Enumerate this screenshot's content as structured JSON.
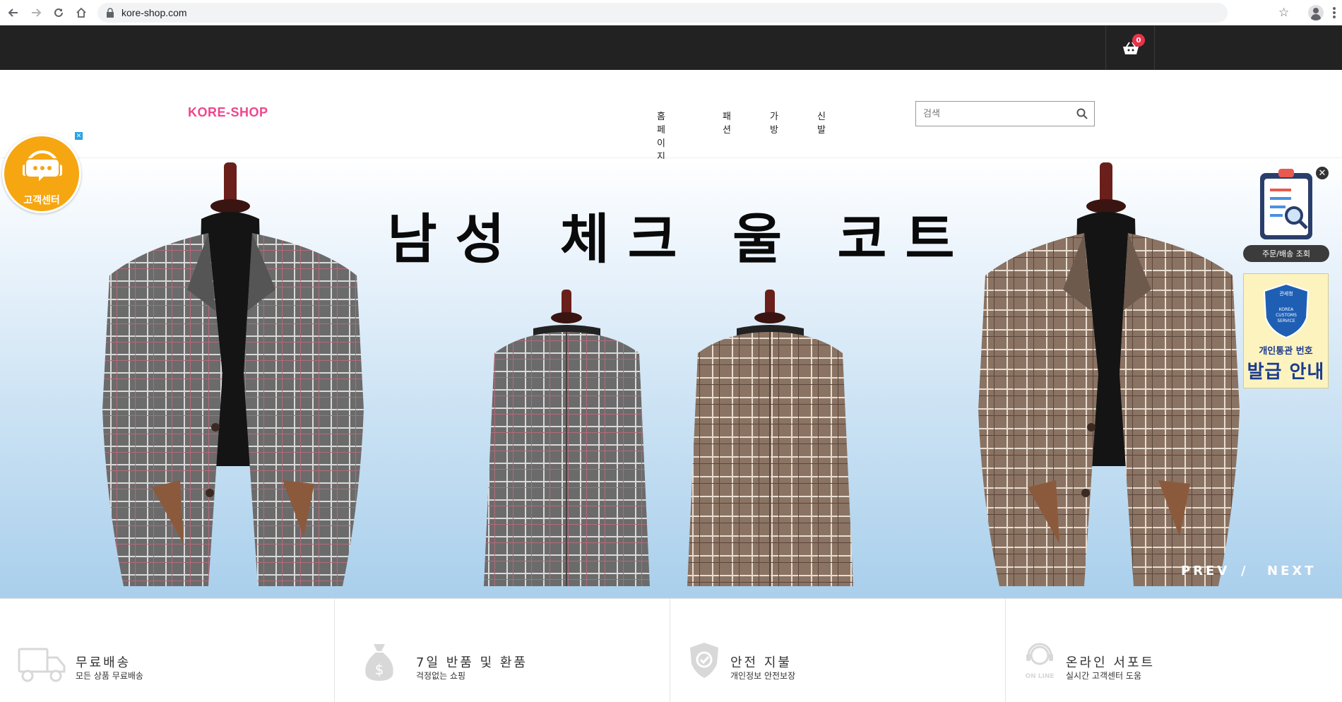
{
  "browser": {
    "url": "kore-shop.com"
  },
  "topbar": {
    "cart_count": "0"
  },
  "header": {
    "logo": "KORE-SHOP",
    "menu": [
      {
        "label": "홈페이지"
      },
      {
        "label": "패션"
      },
      {
        "label": "가방"
      },
      {
        "label": "신발"
      }
    ],
    "search_placeholder": "검색"
  },
  "hero": {
    "title": "남성 체크 울 코트",
    "prev_label": "PREV",
    "slash": "/",
    "next_label": "NEXT"
  },
  "widgets": {
    "customer_center": "고객센터",
    "order_lookup": "주문/배송 조회",
    "customs_line1": "개인통관 번호",
    "customs_line2": "발급 안내",
    "customs_badge_top": "관세청",
    "customs_badge_text": "KOREA CUSTOMS SERVICE"
  },
  "features": [
    {
      "title": "무료배송",
      "subtitle": "모든 상품 무료배송",
      "icon": "truck-icon"
    },
    {
      "title": "7일 반품 및 환품",
      "subtitle": "걱정없는 쇼핑",
      "icon": "money-bag-icon"
    },
    {
      "title": "안전 지불",
      "subtitle": "개인정보 안전보장",
      "icon": "shield-check-icon"
    },
    {
      "title": "온라인 서포트",
      "subtitle": "실시간 고객센터 도움",
      "icon": "support-agent-icon"
    }
  ],
  "colors": {
    "brand": "#f0468c",
    "topbar": "#222222",
    "cart_badge": "#e8334a",
    "cs_badge": "#f6a611",
    "customs_text": "#1c3b8f"
  }
}
